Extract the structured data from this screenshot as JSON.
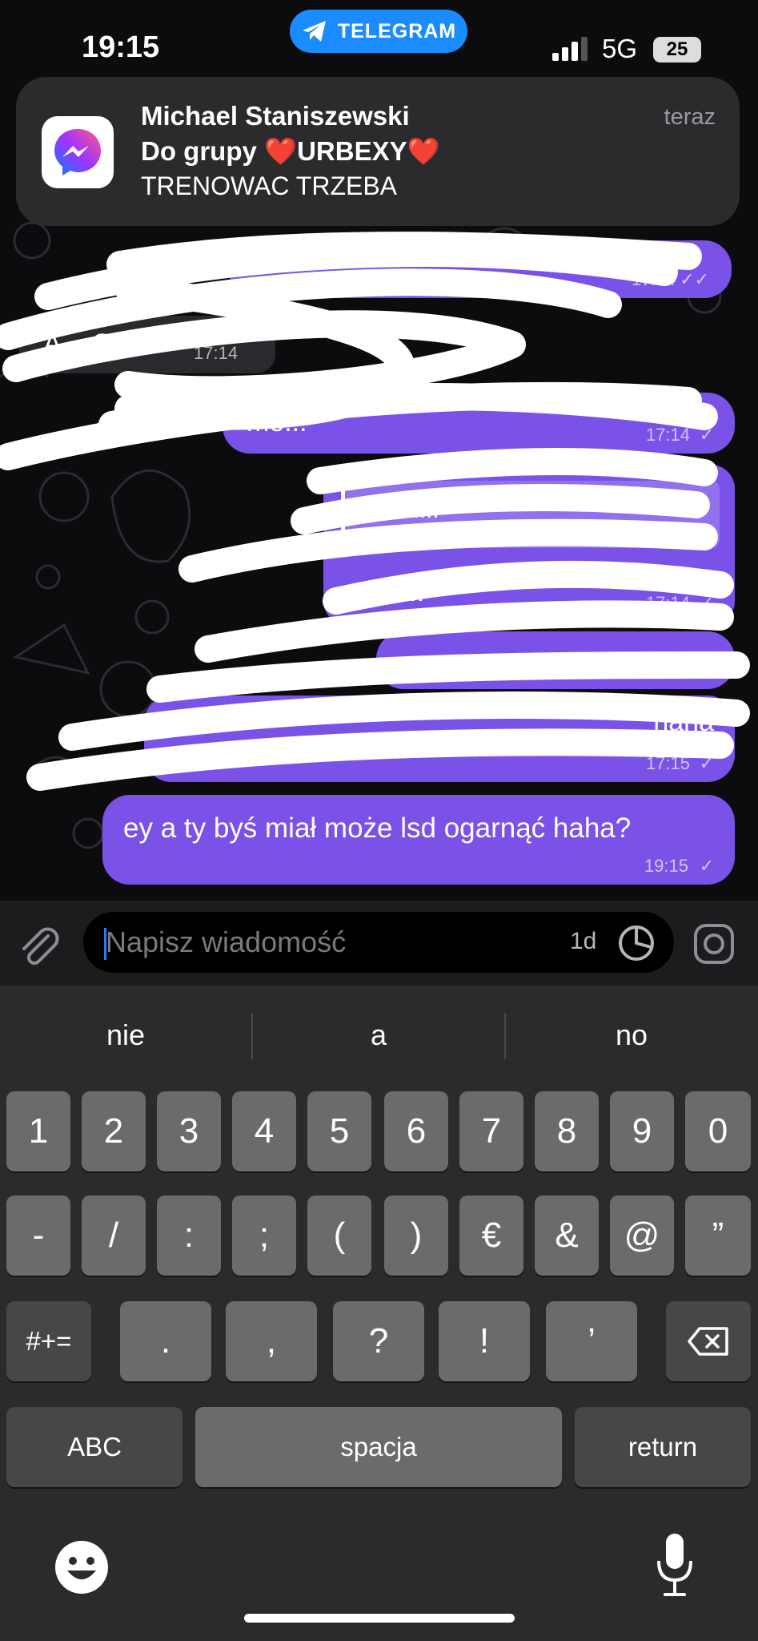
{
  "status_bar": {
    "time": "19:15",
    "return_app": "TELEGRAM",
    "network": "5G",
    "battery": "25"
  },
  "notification": {
    "sender": "Michael Staniszewski",
    "group_prefix": "Do grupy",
    "group_name": "URBEXY",
    "heart": "❤️",
    "message": "TRENOWAC TRZEBA",
    "time": "teraz",
    "app_icon": "messenger-icon"
  },
  "chat": {
    "wallpaper_color": "#0c0b0e",
    "outgoing_color": "#7b52e8",
    "messages": [
      {
        "dir": "out",
        "text": "",
        "time": "17:14",
        "check": "✓✓"
      },
      {
        "dir": "in",
        "text": "A... OK",
        "time": "17:14"
      },
      {
        "dir": "out",
        "text": "mo...",
        "time": "17:14",
        "check": "✓"
      },
      {
        "dir": "out",
        "text": "u kie...",
        "time": "17:14",
        "check": "✓",
        "quote": "...t An..."
      },
      {
        "dir": "out",
        "text": "",
        "time": "17:14",
        "check": "✓"
      },
      {
        "dir": "out",
        "text": "haha",
        "time": "17:15",
        "check": "✓"
      },
      {
        "dir": "out",
        "text": "ey a ty byś miał może lsd ogarnąć haha?",
        "time": "19:15",
        "check": "✓"
      }
    ]
  },
  "composer": {
    "placeholder": "Napisz wiadomość",
    "timer": "1d"
  },
  "keyboard": {
    "suggestions": [
      "nie",
      "a",
      "no"
    ],
    "row1": [
      "1",
      "2",
      "3",
      "4",
      "5",
      "6",
      "7",
      "8",
      "9",
      "0"
    ],
    "row2": [
      "-",
      "/",
      ":",
      ";",
      "(",
      ")",
      "€",
      "&",
      "@",
      "”"
    ],
    "row3": {
      "shift": "#+=",
      "keys": [
        ".",
        ",",
        "?",
        "!",
        "’"
      ]
    },
    "row4": {
      "abc": "ABC",
      "space": "spacja",
      "return": "return"
    }
  }
}
